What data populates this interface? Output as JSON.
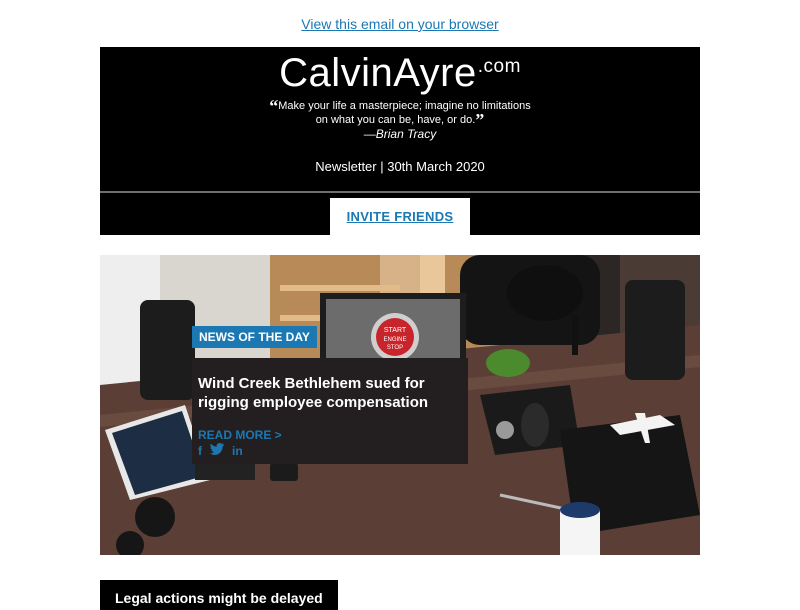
{
  "top_link": {
    "text": "View this email on your browser"
  },
  "header": {
    "logo_main": "CalvinAyre",
    "logo_tld": ".com",
    "quote_line1": "Make your life a masterpiece; imagine no limitations",
    "quote_line2": "on what you can be, have, or do.",
    "quote_open": "“",
    "quote_close": "”",
    "author": "—Brian Tracy",
    "date": "Newsletter | 30th March 2020",
    "invite_label": "INVITE FRIENDS"
  },
  "hero": {
    "tag": "NEWS OF THE DAY",
    "title": "Wind Creek Bethlehem sued for rigging employee compensation",
    "read_more": "READ MORE >",
    "screen_text": [
      "START",
      "ENGINE",
      "STOP"
    ]
  },
  "socials": [
    {
      "icon": "facebook-icon",
      "glyph": "f"
    },
    {
      "icon": "twitter-icon",
      "glyph": "🐦"
    },
    {
      "icon": "linkedin-icon",
      "glyph": "in"
    }
  ],
  "next_section": {
    "title": "Legal actions might be delayed"
  },
  "colors": {
    "accent": "#1b78b3",
    "header_bg": "#000000",
    "card_bg": "#231f20"
  }
}
